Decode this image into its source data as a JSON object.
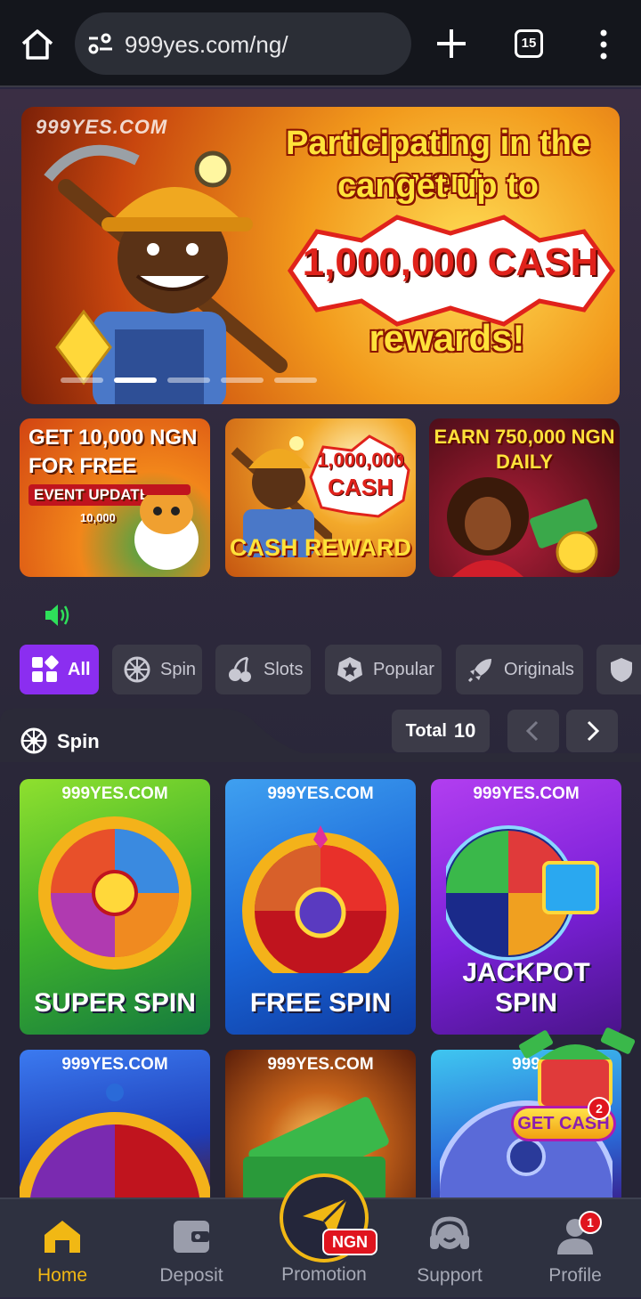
{
  "browser": {
    "url": "999yes.com/ng/",
    "tab_count": "15"
  },
  "banner": {
    "brand": "999YES.COM",
    "headline_1": "Participating in the event",
    "headline_2": "canget up to",
    "amount": "1,000,000 CASH",
    "tail": "rewards!",
    "slide_count": 5,
    "active_slide": 2
  },
  "promos": [
    {
      "line1": "GET 10,000 NGN",
      "line2": "FOR FREE",
      "line3": "EVENT UPDATE!",
      "line4": "10,000"
    },
    {
      "line1": "1,000,000",
      "line2": "CASH",
      "line3": "CASH REWARD"
    },
    {
      "line1": "EARN 750,000 NGN",
      "line2": "DAILY"
    }
  ],
  "categories": [
    {
      "label": "All",
      "icon": "grid-icon",
      "active": true
    },
    {
      "label": "Spin",
      "icon": "wheel-icon"
    },
    {
      "label": "Slots",
      "icon": "cherries-icon"
    },
    {
      "label": "Popular",
      "icon": "star-badge-icon"
    },
    {
      "label": "Originals",
      "icon": "rocket-icon"
    }
  ],
  "section": {
    "title": "Spin",
    "total_label": "Total",
    "total_value": "10"
  },
  "games": [
    {
      "brand": "999YES.COM",
      "name": "SUPER SPIN"
    },
    {
      "brand": "999YES.COM",
      "name": "FREE SPIN"
    },
    {
      "brand": "999YES.COM",
      "name": "JACKPOT SPIN"
    },
    {
      "brand": "999YES.COM",
      "name": ""
    },
    {
      "brand": "999YES.COM",
      "name": ""
    },
    {
      "brand": "999",
      "name": ""
    }
  ],
  "floating": {
    "label": "GET CASH",
    "badge": "2"
  },
  "bottom_nav": {
    "home": "Home",
    "deposit": "Deposit",
    "promotion": "Promotion",
    "promotion_tag": "NGN",
    "support": "Support",
    "profile": "Profile",
    "profile_badge": "1"
  },
  "colors": {
    "accent": "#8b2ef0",
    "active_nav": "#f1b814",
    "badge": "#e0141e",
    "speaker": "#2ee05a"
  }
}
